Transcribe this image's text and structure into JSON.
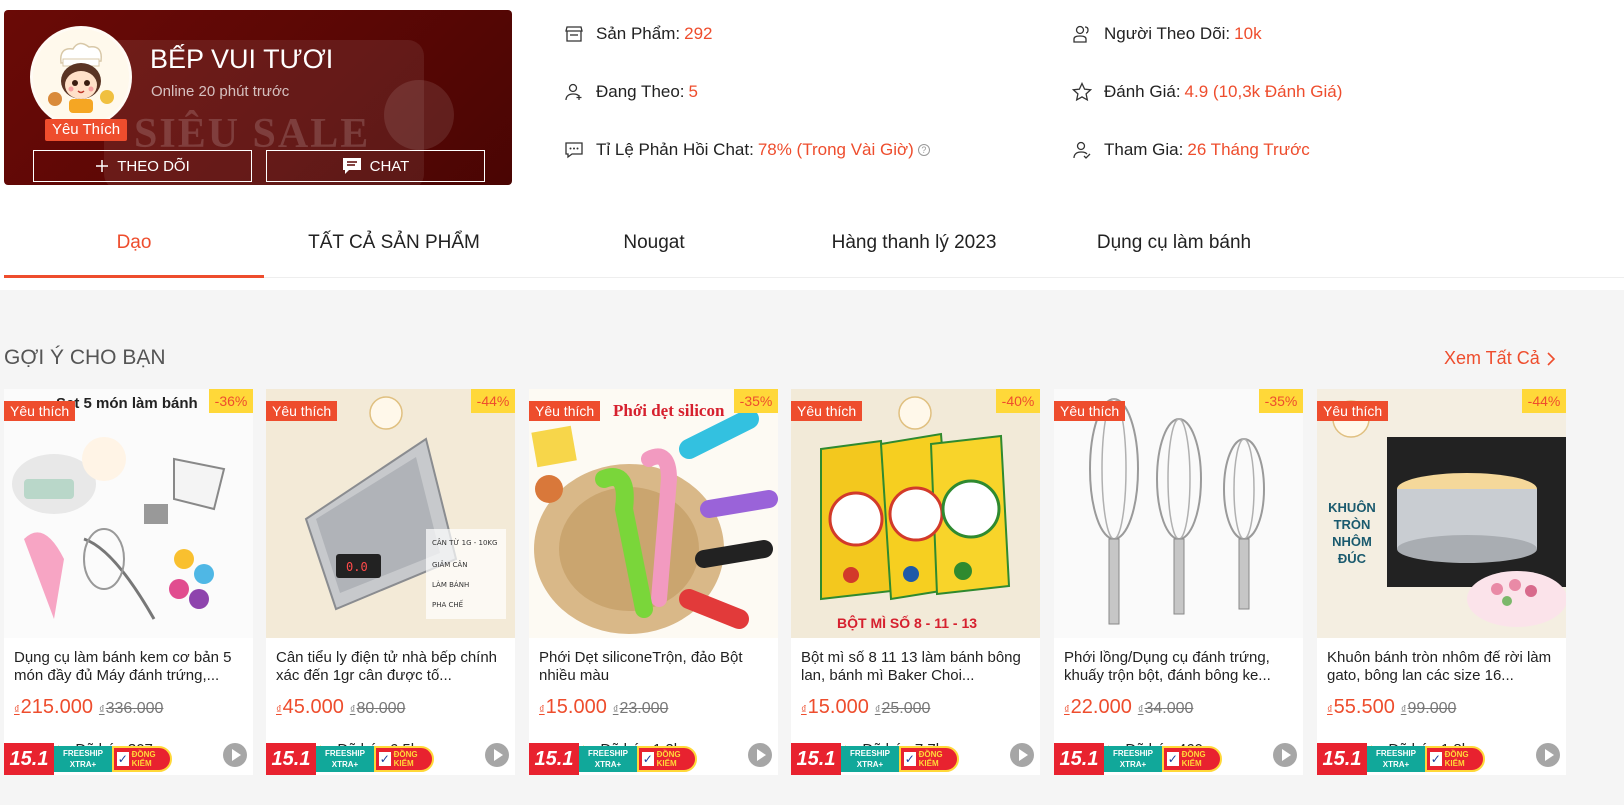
{
  "shop": {
    "name": "BẾP VUI TƯƠI",
    "online": "Online 20 phút trước",
    "fav_badge": "Yêu Thích",
    "banner_text": "SIÊU SALE",
    "follow_label": "THEO DÕI",
    "chat_label": "CHAT"
  },
  "stats": {
    "products_label": "Sản Phẩm:",
    "products_value": "292",
    "following_label": "Đang Theo:",
    "following_value": "5",
    "chat_label": "Tỉ Lệ Phản Hồi Chat:",
    "chat_value": "78% (Trong Vài Giờ)",
    "followers_label": "Người Theo Dõi:",
    "followers_value": "10k",
    "rating_label": "Đánh Giá:",
    "rating_value": "4.9 (10,3k Đánh Giá)",
    "joined_label": "Tham Gia:",
    "joined_value": "26 Tháng Trước"
  },
  "tabs": [
    {
      "label": "Dạo",
      "active": true
    },
    {
      "label": "TẤT CẢ SẢN PHẨM",
      "active": false
    },
    {
      "label": "Nougat",
      "active": false
    },
    {
      "label": "Hàng thanh lý 2023",
      "active": false
    },
    {
      "label": "Dụng cụ làm bánh",
      "active": false
    }
  ],
  "section": {
    "title": "GỢI Ý CHO BẠN",
    "see_all": "Xem Tất Cả"
  },
  "colors": {
    "accent": "#ee4d2d",
    "header_bg": "#5a0705",
    "discount_bg": "#ffd839"
  },
  "promo": {
    "sale": "15.1",
    "freeship": "FREESHIP XTRA+",
    "check": "ĐỒNG KIỂM"
  },
  "products": [
    {
      "fav": "Yêu thích",
      "discount": "-36%",
      "name": "Dụng cụ làm bánh kem cơ bản 5 món đầy đủ Máy đánh trứng,...",
      "currency": "₫",
      "price": "215.000",
      "old_price": "336.000",
      "sold": "Đã bán 307",
      "image_title": "Set 5 món làm bánh"
    },
    {
      "fav": "Yêu thích",
      "discount": "-44%",
      "name": "Cân tiểu ly điện tử nhà bếp chính xác đến 1gr cân được tố...",
      "currency": "₫",
      "price": "45.000",
      "old_price": "80.000",
      "sold": "Đã bán 6,5k",
      "image_title": ""
    },
    {
      "fav": "Yêu thích",
      "discount": "-35%",
      "name": "Phới Dẹt siliconeTrộn, đảo Bột nhiều màu",
      "currency": "₫",
      "price": "15.000",
      "old_price": "23.000",
      "sold": "Đã bán 1,2k",
      "image_title": "Phới dẹt silicon"
    },
    {
      "fav": "Yêu thích",
      "discount": "-40%",
      "name": "Bột mì số 8 11 13 làm bánh bông lan, bánh mì Baker Choi...",
      "currency": "₫",
      "price": "15.000",
      "old_price": "25.000",
      "sold": "Đã bán 7,7k",
      "image_title": "BỘT MÌ SỐ 8 - 11 - 13"
    },
    {
      "fav": "Yêu thích",
      "discount": "-35%",
      "name": "Phới lồng/Dụng cụ đánh trứng, khuấy trộn bột, đánh bông ke...",
      "currency": "₫",
      "price": "22.000",
      "old_price": "34.000",
      "sold": "Đã bán 460",
      "image_title": ""
    },
    {
      "fav": "Yêu thích",
      "discount": "-44%",
      "name": "Khuôn bánh tròn nhôm đế rời làm gato, bông lan các size 16...",
      "currency": "₫",
      "price": "55.500",
      "old_price": "99.000",
      "sold": "Đã bán 1,8k",
      "image_title": "KHUÔN TRÒN NHÔM ĐÚC"
    }
  ]
}
